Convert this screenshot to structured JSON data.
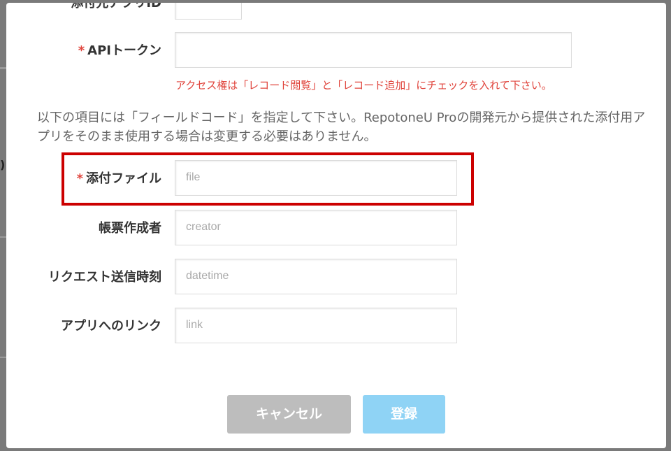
{
  "background": {
    "partial_label": ")"
  },
  "form": {
    "top_row_label": "添付先アプリID",
    "api_token": {
      "required_mark": "*",
      "label": "APIトークン",
      "value": ""
    },
    "warning": "アクセス権は「レコード閲覧」と「レコード追加」にチェックを入れて下さい。",
    "note": "以下の項目には「フィールドコード」を指定して下さい。RepotoneU Proの開発元から提供された添付用アプリをそのまま使用する場合は変更する必要はありません。",
    "attachment": {
      "required_mark": "*",
      "label": "添付ファイル",
      "placeholder": "file"
    },
    "creator": {
      "label": "帳票作成者",
      "placeholder": "creator"
    },
    "request_time": {
      "label": "リクエスト送信時刻",
      "placeholder": "datetime"
    },
    "app_link": {
      "label": "アプリへのリンク",
      "placeholder": "link"
    }
  },
  "buttons": {
    "cancel": "キャンセル",
    "save": "登録"
  },
  "colors": {
    "required": "#e0443c",
    "highlight": "#cc0000",
    "cancel_bg": "#bdbdbd",
    "save_bg": "#8fd3f5"
  }
}
